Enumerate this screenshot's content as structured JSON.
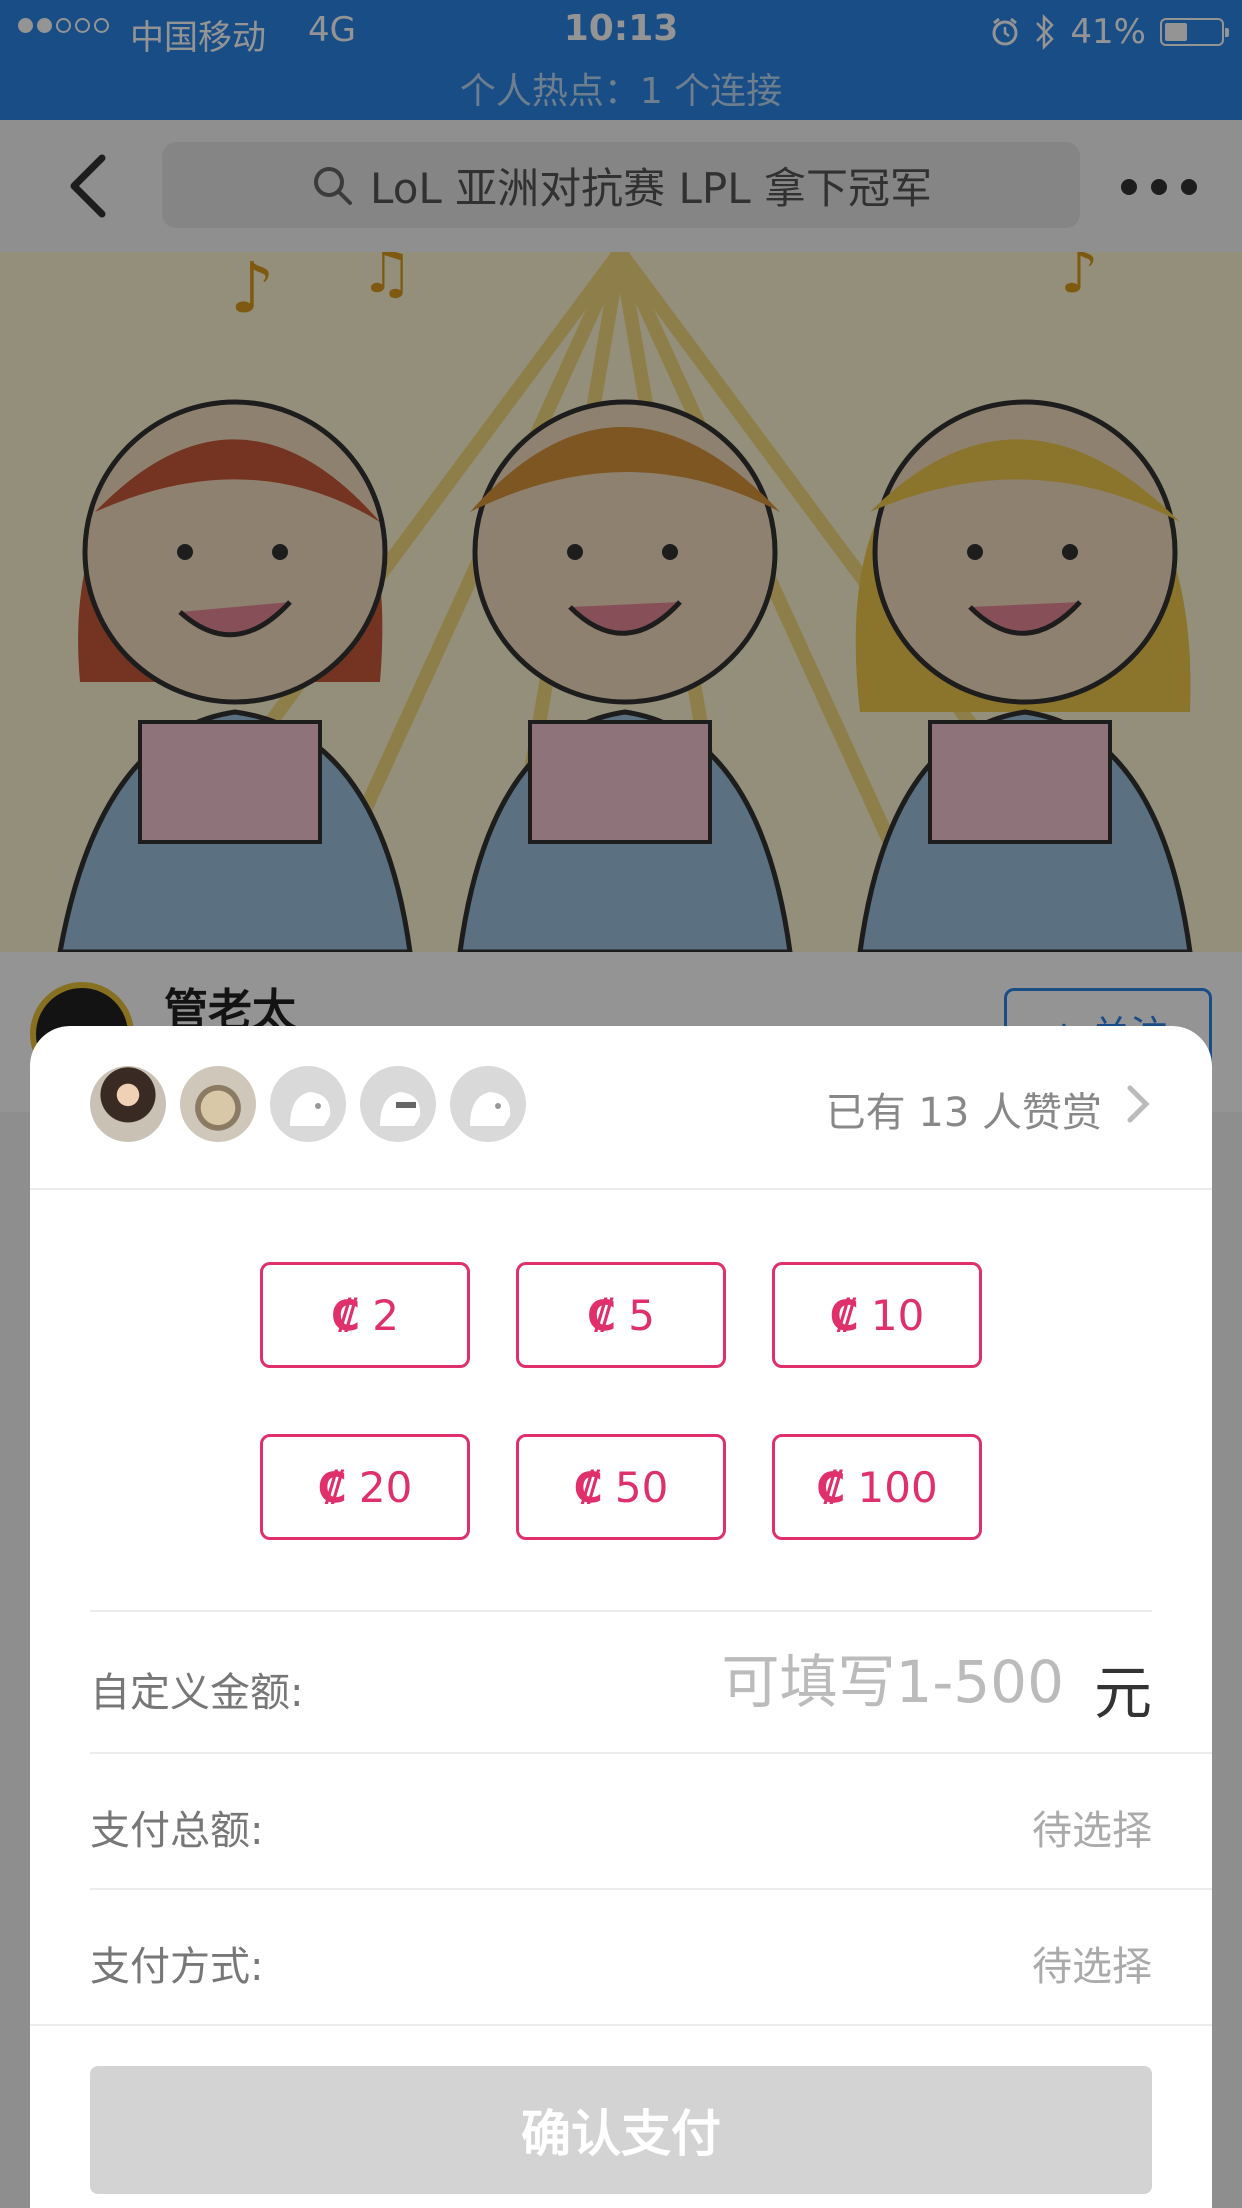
{
  "status_bar": {
    "carrier": "中国移动",
    "network": "4G",
    "time": "10:13",
    "battery_percent": "41%",
    "battery_level": 0.41,
    "signal_bars_filled": 2,
    "signal_bars_total": 5,
    "hotspot": "个人热点：1 个连接"
  },
  "navbar": {
    "search_text": "LoL 亚洲对抗赛 LPL 拿下冠军"
  },
  "author": {
    "name": "管老太",
    "follow_label": "+ 关注"
  },
  "tip_sheet": {
    "tip_count_text": "已有 13 人赞赏",
    "amount_symbol": "₡",
    "amounts": [
      "2",
      "5",
      "10",
      "20",
      "50",
      "100"
    ],
    "custom_amount_label": "自定义金额:",
    "custom_amount_placeholder": "可填写1-500",
    "custom_amount_value": "",
    "currency_unit": "元",
    "total_label": "支付总额:",
    "total_value": "待选择",
    "method_label": "支付方式:",
    "method_value": "待选择",
    "confirm_label": "确认支付"
  },
  "colors": {
    "brand_blue": "#2b85e6",
    "accent_pink": "#e0306b",
    "disabled_gray": "#d3d3d3"
  }
}
